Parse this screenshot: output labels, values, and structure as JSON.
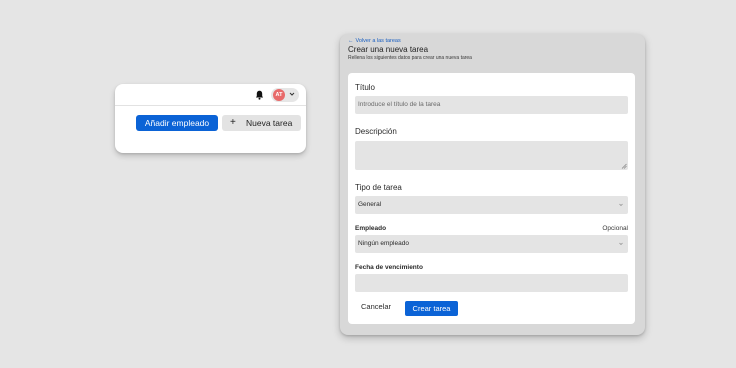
{
  "header": {
    "avatar_initials": "AT",
    "bell_icon": "bell-icon",
    "add_employee_label": "Añadir empleado",
    "new_task_plus": "+",
    "new_task_label": "Nueva tarea"
  },
  "form": {
    "back_link": "Volver a las tareas",
    "title": "Crear una nueva tarea",
    "subtitle": "Rellena los siguientes datos para crear una nueva tarea",
    "title_label": "Título",
    "title_placeholder": "Introduce el título de la tarea",
    "description_label": "Descripción",
    "type_label": "Tipo de tarea",
    "type_value": "General",
    "employee_label": "Empleado",
    "employee_optional": "Opcional",
    "employee_value": "Ningún empleado",
    "due_date_label": "Fecha de vencimiento",
    "cancel_label": "Cancelar",
    "create_label": "Crear tarea"
  },
  "colors": {
    "background": "#e5e5e5",
    "primary": "#0b63d6",
    "avatar": "#e86a6a",
    "link": "#1a5fc0"
  }
}
